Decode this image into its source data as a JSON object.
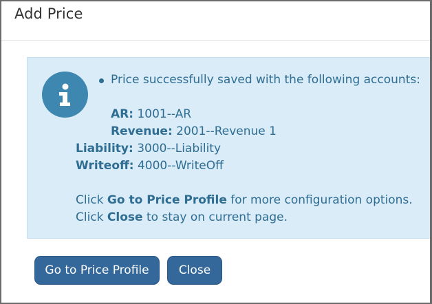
{
  "dialog": {
    "title": "Add Price"
  },
  "message": {
    "icon": "info-icon",
    "line1": "Price successfully saved with the following accounts:",
    "accounts": [
      {
        "label": "AR:",
        "value": "1001--AR"
      },
      {
        "label": "Revenue:",
        "value": "2001--Revenue 1"
      },
      {
        "label": "Liability:",
        "value": "3000--Liability"
      },
      {
        "label": "Writeoff:",
        "value": "4000--WriteOff"
      }
    ],
    "hint1": {
      "prefix": "Click",
      "strong": "Go to Price Profile",
      "suffix": "for more configuration options."
    },
    "hint2": {
      "prefix": "Click",
      "strong": "Close",
      "suffix": "to stay on current page."
    }
  },
  "buttons": {
    "go_to_profile": "Go to Price Profile",
    "close": "Close"
  },
  "colors": {
    "alert_bg": "#d9ecf7",
    "alert_text": "#2f6d93",
    "icon_circle": "#3d87b0",
    "button_bg": "#34679a"
  }
}
